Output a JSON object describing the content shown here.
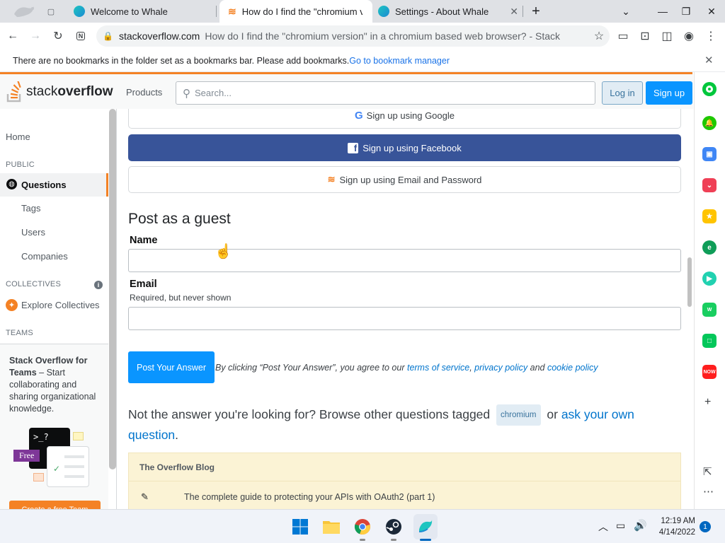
{
  "browser": {
    "tabs": [
      {
        "title": "Welcome to Whale"
      },
      {
        "title": "How do I find the \"chromium v"
      },
      {
        "title": "Settings - About Whale"
      }
    ],
    "new_tab_glyph": "+",
    "address": {
      "host": "stackoverflow.com",
      "path": "How do I find the \"chromium version\" in a chromium based web browser? - Stack"
    },
    "bookmark_bar": {
      "message": "There are no bookmarks in the folder set as a bookmarks bar. Please add bookmarks.",
      "link": "Go to bookmark manager"
    }
  },
  "so": {
    "logo_stack": "stack",
    "logo_overflow": "overflow",
    "products": "Products",
    "search_placeholder": "Search...",
    "login": "Log in",
    "signup": "Sign up"
  },
  "leftnav": {
    "home": "Home",
    "public_heading": "PUBLIC",
    "questions": "Questions",
    "tags": "Tags",
    "users": "Users",
    "companies": "Companies",
    "collectives_heading": "COLLECTIVES",
    "explore_collectives": "Explore Collectives",
    "teams_heading": "TEAMS",
    "teams_title": "Stack Overflow for Teams",
    "teams_desc": " – Start collaborating and sharing organizational knowledge.",
    "teams_free": "Free",
    "teams_terminal": ">_?",
    "create_team": "Create a free Team"
  },
  "main": {
    "signup_google": "Sign up using Google",
    "signup_facebook": "Sign up using Facebook",
    "signup_email": "Sign up using Email and Password",
    "guest_heading": "Post as a guest",
    "name_label": "Name",
    "email_label": "Email",
    "email_hint": "Required, but never shown",
    "post_button": "Post Your Answer",
    "agree_prefix": "By clicking “Post Your Answer”, you agree to our ",
    "terms": "terms of service",
    "comma": ", ",
    "privacy": "privacy policy",
    "and": " and ",
    "cookie": "cookie policy",
    "not_answer": "Not the answer you're looking for? Browse other questions tagged",
    "tag": "chromium",
    "or": "or",
    "ask_own": "ask your own question",
    "period": ".",
    "blog_heading": "The Overflow Blog",
    "blog_item": "The complete guide to protecting your APIs with OAuth2 (part 1)"
  },
  "taskbar": {
    "time": "12:19 AM",
    "date": "4/14/2022",
    "notification_count": "1"
  },
  "colors": {
    "so_orange": "#f48225",
    "so_blue": "#0a95ff",
    "facebook": "#385499",
    "link": "#0074cc"
  }
}
